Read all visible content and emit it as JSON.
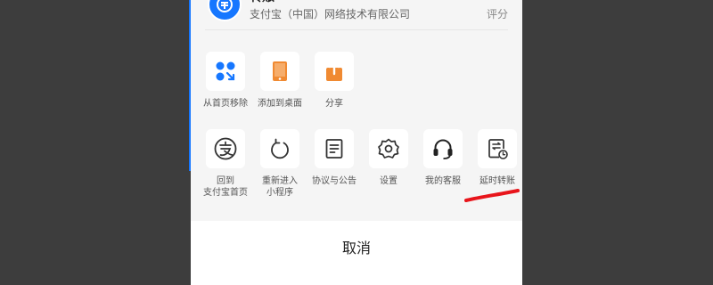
{
  "app": {
    "name": "转账",
    "company": "支付宝（中国）网络技术有限公司",
    "rating_value": "",
    "rating_label": "评分"
  },
  "row1": [
    {
      "label": "从首页移除",
      "icon": "remove-from-home-icon"
    },
    {
      "label": "添加到桌面",
      "icon": "add-to-desktop-icon"
    },
    {
      "label": "分享",
      "icon": "share-icon"
    }
  ],
  "row2": [
    {
      "label": "回到\n支付宝首页",
      "icon": "alipay-home-icon"
    },
    {
      "label": "重新进入\n小程序",
      "icon": "reload-icon"
    },
    {
      "label": "协议与公告",
      "icon": "document-icon"
    },
    {
      "label": "设置",
      "icon": "gear-icon"
    },
    {
      "label": "我的客服",
      "icon": "headset-icon"
    },
    {
      "label": "延时转账",
      "icon": "delayed-transfer-icon"
    }
  ],
  "cancel_label": "取消",
  "colors": {
    "accent_blue": "#1677ff",
    "accent_orange": "#f08a32",
    "annotation_red": "#e8151b"
  }
}
